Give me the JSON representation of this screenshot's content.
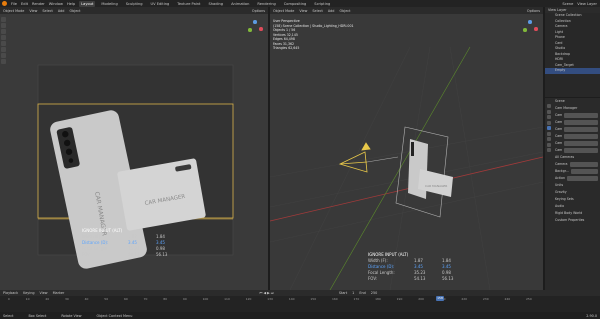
{
  "topbar": {
    "menus": [
      "File",
      "Edit",
      "Render",
      "Window",
      "Help"
    ],
    "workspaces": [
      "Layout",
      "Modeling",
      "Sculpting",
      "UV Editing",
      "Texture Paint",
      "Shading",
      "Animation",
      "Rendering",
      "Compositing",
      "Scripting"
    ],
    "active_workspace": "Layout",
    "scene": "Scene",
    "view_layer": "View Layer"
  },
  "left_view": {
    "mode": "Object Mode",
    "menus": [
      "View",
      "Select",
      "Add",
      "Object"
    ],
    "options": "Options",
    "phone_text": "CAR MANAGER",
    "card_text": "CAR MANAGER",
    "overlay": {
      "title": "IGNORE INPUT (ALT)",
      "rows": [
        {
          "label": "Width (F):",
          "a": "1.87",
          "b": "1.84"
        },
        {
          "label": "Distance (D):",
          "a": "3.45",
          "b": "3.45"
        },
        {
          "label": "Focal Length:",
          "a": "35.23",
          "b": "0.98"
        },
        {
          "label": "FOV:",
          "a": "54.13",
          "b": "56.13"
        }
      ]
    }
  },
  "mid_view": {
    "mode": "Object Mode",
    "menus": [
      "View",
      "Select",
      "Add",
      "Object"
    ],
    "options": "Options",
    "info": [
      "User Perspective",
      "(158) Scene Collection | Studio_Lighting_HDRI.001",
      "Objects   1 / 56",
      "Vertices  32,145",
      "Edges     64,498",
      "Faces     31,362",
      "Triangles 62,645"
    ],
    "overlay": {
      "title": "IGNORE INPUT (ALT)",
      "rows": [
        {
          "label": "Width (F):",
          "a": "1.87",
          "b": "1.84"
        },
        {
          "label": "Distance (D):",
          "a": "3.45",
          "b": "3.45"
        },
        {
          "label": "Focal Length:",
          "a": "35.23",
          "b": "0.98"
        },
        {
          "label": "FOV:",
          "a": "54.13",
          "b": "56.13"
        }
      ]
    }
  },
  "outliner": {
    "title": "View Layer",
    "rows": [
      "Scene Collection",
      "Collection",
      "Camera",
      "Light",
      "Phone",
      "Card",
      "Studio",
      "Backdrop",
      "HDRI",
      "Cam_Target",
      "Empty"
    ]
  },
  "properties": {
    "header": "Scene",
    "section1": "Cam Manager",
    "rows": [
      "Cam",
      "Cam",
      "Cam",
      "Cam",
      "Cam",
      "Cam"
    ],
    "section2": "All Cameras",
    "rows2": [
      "Camera",
      "Backgr...",
      "Action"
    ],
    "panels": [
      "Units",
      "Gravity",
      "Keying Sets",
      "Audio",
      "Rigid Body World",
      "Custom Properties"
    ]
  },
  "timeline": {
    "menus": [
      "Playback",
      "Keying",
      "View",
      "Marker"
    ],
    "ticks": [
      "0",
      "10",
      "20",
      "30",
      "40",
      "50",
      "60",
      "70",
      "80",
      "90",
      "100",
      "110",
      "120",
      "130",
      "140",
      "150",
      "160",
      "170",
      "180",
      "190",
      "200",
      "210",
      "220",
      "230",
      "240",
      "250"
    ],
    "current_frame": "158",
    "start_label": "Start",
    "start": "1",
    "end_label": "End",
    "end": "250"
  },
  "statusbar": {
    "items": [
      "Select",
      "Box Select",
      "Rotate View",
      "Object Context Menu"
    ],
    "version": "2.90.0"
  }
}
